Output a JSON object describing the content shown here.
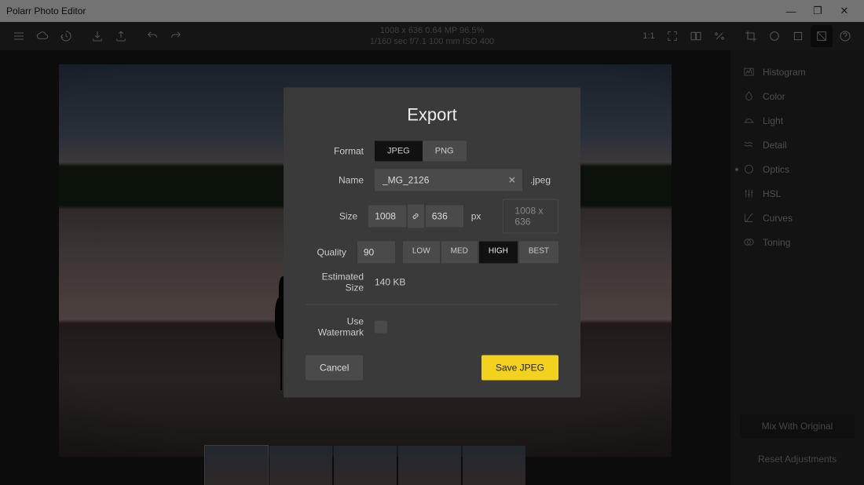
{
  "window": {
    "title": "Polarr Photo Editor"
  },
  "meta": {
    "line1": "1008 x 636    0.64 MP    96.5%",
    "line2": "1/160 sec   f/7.1   100 mm   ISO 400"
  },
  "rightpanel": {
    "items": [
      {
        "label": "Histogram",
        "icon": "histogram"
      },
      {
        "label": "Color",
        "icon": "drop"
      },
      {
        "label": "Light",
        "icon": "sun"
      },
      {
        "label": "Detail",
        "icon": "waves"
      },
      {
        "label": "Optics",
        "icon": "circle",
        "selected": true
      },
      {
        "label": "HSL",
        "icon": "sliders"
      },
      {
        "label": "Curves",
        "icon": "curve"
      },
      {
        "label": "Toning",
        "icon": "tone"
      }
    ],
    "mix": "Mix With Original",
    "reset": "Reset Adjustments"
  },
  "export": {
    "title": "Export",
    "format_label": "Format",
    "formats": {
      "jpeg": "JPEG",
      "png": "PNG",
      "active": "JPEG"
    },
    "name_label": "Name",
    "name_value": "_MG_2126",
    "extension": ".jpeg",
    "size_label": "Size",
    "width": "1008",
    "height": "636",
    "unit": "px",
    "size_display": "1008 x 636",
    "quality_label": "Quality",
    "quality_value": "90",
    "quality_presets": {
      "low": "LOW",
      "med": "MED",
      "high": "HIGH",
      "best": "BEST",
      "active": "HIGH"
    },
    "estimated_label": "Estimated Size",
    "estimated_value": "140 KB",
    "watermark_label": "Use Watermark",
    "cancel": "Cancel",
    "save": "Save JPEG"
  }
}
